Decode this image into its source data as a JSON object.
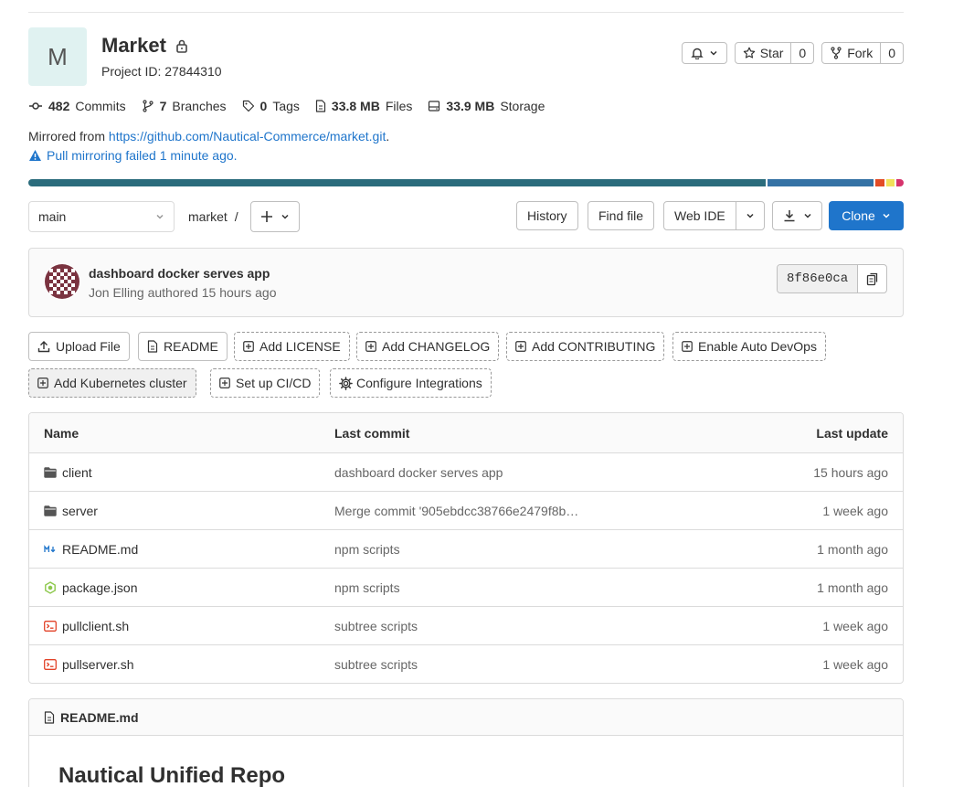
{
  "project": {
    "avatar_letter": "M",
    "name": "Market",
    "id_label": "Project ID: 27844310"
  },
  "header_buttons": {
    "star_label": "Star",
    "star_count": "0",
    "fork_label": "Fork",
    "fork_count": "0"
  },
  "stats": [
    {
      "value": "482",
      "label": "Commits"
    },
    {
      "value": "7",
      "label": "Branches"
    },
    {
      "value": "0",
      "label": "Tags"
    },
    {
      "value": "33.8 MB",
      "label": "Files"
    },
    {
      "value": "33.9 MB",
      "label": "Storage"
    }
  ],
  "mirror": {
    "prefix": "Mirrored from",
    "url": "https://github.com/Nautical-Commerce/market.git",
    "suffix": ".",
    "failed": "Pull mirroring failed 1 minute ago."
  },
  "language_bar": [
    {
      "color": "#2b6c7c",
      "share": 84.6
    },
    {
      "color": "#3572a5",
      "share": 12.2
    },
    {
      "color": "#e34c26",
      "share": 1.0
    },
    {
      "color": "#f1e05a",
      "share": 1.0
    },
    {
      "color": "#d6336c",
      "share": 0.8
    }
  ],
  "toolbar": {
    "branch": "main",
    "path": "market",
    "path_sep": "/",
    "history": "History",
    "find_file": "Find file",
    "web_ide": "Web IDE",
    "clone": "Clone"
  },
  "commit": {
    "title": "dashboard docker serves app",
    "author": "Jon Elling",
    "authored": "authored",
    "time": "15 hours ago",
    "sha": "8f86e0ca"
  },
  "quick_actions": [
    {
      "label": "Upload File",
      "icon": "upload-icon"
    },
    {
      "label": "README",
      "icon": "doc-icon"
    },
    {
      "label": "Add LICENSE",
      "icon": "plus-square-icon"
    },
    {
      "label": "Add CHANGELOG",
      "icon": "plus-square-icon"
    },
    {
      "label": "Add CONTRIBUTING",
      "icon": "plus-square-icon"
    },
    {
      "label": "Enable Auto DevOps",
      "icon": "plus-square-icon"
    },
    {
      "label": "Add Kubernetes cluster",
      "icon": "plus-square-icon"
    },
    {
      "label": "Set up CI/CD",
      "icon": "plus-square-icon"
    },
    {
      "label": "Configure Integrations",
      "icon": "gear-icon"
    }
  ],
  "files": {
    "headers": [
      "Name",
      "Last commit",
      "Last update"
    ],
    "rows": [
      {
        "name": "client",
        "type": "folder",
        "commit": "dashboard docker serves app",
        "updated": "15 hours ago"
      },
      {
        "name": "server",
        "type": "folder",
        "commit": "Merge commit '905ebdcc38766e2479f8b…",
        "updated": "1 week ago"
      },
      {
        "name": "README.md",
        "type": "markdown",
        "commit": "npm scripts",
        "updated": "1 month ago"
      },
      {
        "name": "package.json",
        "type": "node",
        "commit": "npm scripts",
        "updated": "1 month ago"
      },
      {
        "name": "pullclient.sh",
        "type": "shell",
        "commit": "subtree scripts",
        "updated": "1 week ago"
      },
      {
        "name": "pullserver.sh",
        "type": "shell",
        "commit": "subtree scripts",
        "updated": "1 week ago"
      }
    ]
  },
  "readme": {
    "filename": "README.md",
    "heading": "Nautical Unified Repo"
  },
  "colors": {
    "primary": "#1f75cb",
    "border": "#dbdbdb"
  }
}
